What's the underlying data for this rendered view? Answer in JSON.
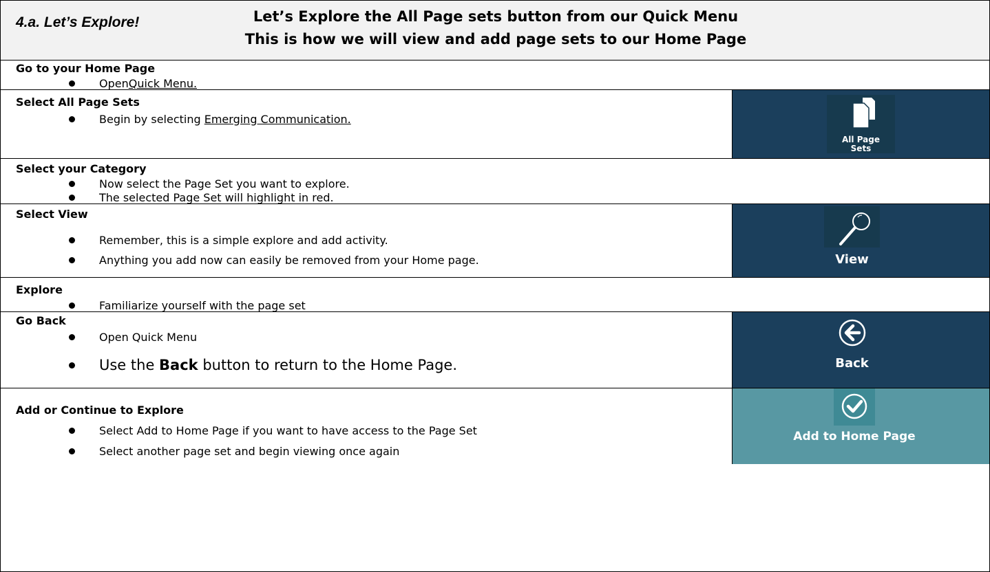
{
  "header": {
    "lead": "4.a. Let’s Explore!",
    "line1": "Let’s Explore the All Page sets button from our Quick Menu",
    "line2": "This is how we will view and add page sets to our Home Page"
  },
  "steps": [
    {
      "heading": "Go to your Home Page",
      "bullets": [
        "Open",
        "Quick Menu."
      ]
    },
    {
      "heading": "Select All Page Sets",
      "bullets": [
        "Begin by selecting ",
        "Emerging Communication."
      ],
      "tile_label_1": "All Page",
      "tile_label_2": "Sets"
    },
    {
      "heading": "Select your Category",
      "bullets": [
        "Now select the Page Set you want to explore.",
        "The selected Page Set will highlight in red."
      ]
    },
    {
      "heading": "Select View",
      "bullets": [
        "Remember, this is a simple explore and add activity.",
        "Anything you add now can easily be removed from your Home page."
      ],
      "tile_label": "View"
    },
    {
      "heading": "Explore",
      "bullets": [
        "Familiarize yourself with the page set"
      ]
    },
    {
      "heading": "Go Back",
      "bullets": [
        "Open Quick Menu",
        "Use the ",
        "Back",
        " button to return to the Home Page."
      ],
      "tile_label": "Back"
    },
    {
      "heading": "Add or Continue to Explore",
      "bullets": [
        "Select Add to Home Page if you want to have access to the Page Set",
        "Select another page set and begin viewing once again"
      ],
      "tile_label": "Add to Home Page"
    }
  ],
  "colors": {
    "panel_navy": "#1b3f5c",
    "panel_teal": "#5898a3",
    "tile_dark": "#173a4e",
    "header_bg": "#f2f2f2"
  },
  "icons": [
    "documents-icon",
    "magnifier-icon",
    "back-arrow-icon",
    "checkmark-icon"
  ]
}
